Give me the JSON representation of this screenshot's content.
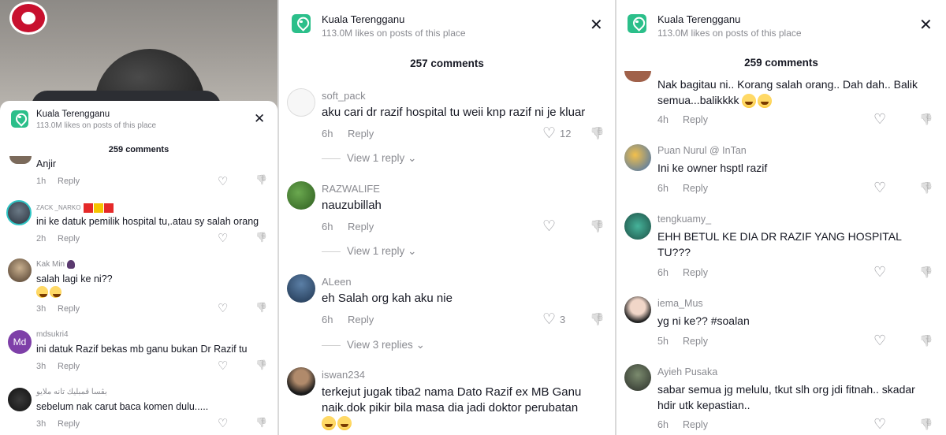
{
  "place": {
    "name": "Kuala Terengganu",
    "likes": "113.0M likes on posts of this place"
  },
  "icons": {
    "heart": "♡",
    "dislike": "👎",
    "close": "✕",
    "chevron": "⌄"
  },
  "colors": {
    "place_icon": "#2bbf8a",
    "text": "#161823",
    "muted": "#8a8b91"
  },
  "panel1": {
    "count": "259 comments",
    "comments": [
      {
        "name": "",
        "text": "Anjir",
        "time": "1h",
        "reply": "Reply"
      },
      {
        "name": "ZACK _NARKO",
        "text": "ini ke datuk pemilik hospital tu,.atau sy salah orang",
        "time": "2h",
        "reply": "Reply"
      },
      {
        "name": "Kak Min",
        "text": "salah lagi ke ni??",
        "time": "3h",
        "reply": "Reply"
      },
      {
        "name": "mdsukri4",
        "text": "ini datuk Razif bekas mb ganu bukan Dr Razif tu",
        "time": "3h",
        "reply": "Reply",
        "initials": "Md"
      },
      {
        "name": "بڤسا ڤمبليك تانه ملايو",
        "text": "sebelum nak carut baca komen dulu.....",
        "time": "3h",
        "reply": "Reply"
      }
    ]
  },
  "panel2": {
    "count": "257 comments",
    "comments": [
      {
        "name": "soft_pack",
        "text": "aku cari dr razif hospital tu weii knp razif ni je kluar",
        "time": "6h",
        "reply": "Reply",
        "likes": "12",
        "view_replies": "View 1 reply"
      },
      {
        "name": "RAZWALIFE",
        "text": "nauzubillah",
        "time": "6h",
        "reply": "Reply",
        "view_replies": "View 1 reply"
      },
      {
        "name": "ALeen",
        "text": "eh Salah org kah aku nie",
        "time": "6h",
        "reply": "Reply",
        "likes": "3",
        "view_replies": "View 3 replies"
      },
      {
        "name": "iswan234",
        "text": "terkejut jugak tiba2 nama Dato Razif ex MB Ganu naik.dok pikir bila masa dia jadi doktor perubatan"
      }
    ]
  },
  "panel3": {
    "count": "259 comments",
    "comments": [
      {
        "name": "",
        "text": "Nak bagitau ni.. Korang salah orang.. Dah dah.. Balik semua...balikkkk",
        "time": "4h",
        "reply": "Reply"
      },
      {
        "name": "Puan Nurul @ InTan",
        "text": "Ini ke owner hsptl razif",
        "time": "6h",
        "reply": "Reply"
      },
      {
        "name": "tengkuamy_",
        "text": "EHH BETUL KE DIA DR RAZIF YANG HOSPITAL TU???",
        "time": "6h",
        "reply": "Reply"
      },
      {
        "name": "iema_Mus",
        "text": "yg ni ke?? #soalan",
        "time": "5h",
        "reply": "Reply"
      },
      {
        "name": "Ayieh Pusaka",
        "text": "sabar semua jg melulu, tkut slh org jdi fitnah.. skadar hdir utk kepastian..",
        "time": "6h",
        "reply": "Reply"
      }
    ]
  }
}
